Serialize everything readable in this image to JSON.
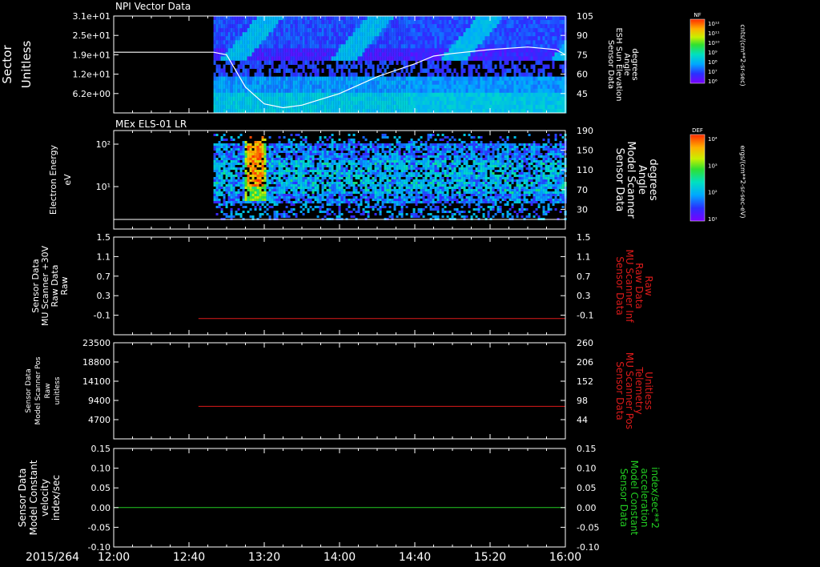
{
  "date_label": "2015/264",
  "time_ticks": [
    "12:00",
    "12:40",
    "13:20",
    "14:00",
    "14:40",
    "15:20",
    "16:00"
  ],
  "colors": {
    "white": "#ffffff",
    "red": "#dd1a1a",
    "green": "#22cc22",
    "background": "#000000"
  },
  "chart_data": [
    {
      "type": "heatmap",
      "title": "NPI Vector Data",
      "ylabel": [
        "Sector",
        "Unitless"
      ],
      "y_ticks": [
        "3.1e+01",
        "2.5e+01",
        "1.9e+01",
        "1.2e+01",
        "6.2e+00"
      ],
      "y2label": [
        "Sensor Data",
        "ESH Sun Elevation",
        "Angle",
        "degrees"
      ],
      "y2_ticks": [
        "105",
        "90",
        "75",
        "60",
        "45"
      ],
      "y2lim": [
        30,
        105
      ],
      "data_start": "12:53",
      "overlay_series": {
        "name": "ESH Sun Elevation Angle",
        "x": [
          "12:00",
          "12:53",
          "13:00",
          "13:10",
          "13:20",
          "13:30",
          "13:40",
          "14:00",
          "14:20",
          "14:40",
          "14:50",
          "15:00",
          "15:20",
          "15:40",
          "15:55",
          "16:00"
        ],
        "values": [
          77,
          77,
          75,
          50,
          37,
          34,
          36,
          45,
          58,
          68,
          74,
          76,
          79,
          81,
          79,
          75
        ]
      },
      "colorbar": {
        "label": "NF",
        "unit": "cnts/(cm**2-sr-sec)",
        "ticks": [
          "10¹²",
          "10¹¹",
          "10¹⁰",
          "10⁹",
          "10⁸",
          "10⁷",
          "10⁶"
        ]
      }
    },
    {
      "type": "heatmap",
      "title": "MEx ELS-01 LR",
      "ylabel": [
        "Electron Energy",
        "eV"
      ],
      "y_ticks": [
        "10²",
        "10¹"
      ],
      "y2label": [
        "Sensor Data",
        "Model Scanner",
        "Angle",
        "degrees"
      ],
      "y2_ticks": [
        "190",
        "150",
        "110",
        "70",
        "30"
      ],
      "data_start": "12:53",
      "burst_time": "13:15",
      "colorbar": {
        "label": "DEF",
        "unit": "ergs/(cm**2-sr-sec-eV)",
        "ticks": [
          "10⁴",
          "10³",
          "10²",
          "10¹"
        ]
      }
    },
    {
      "type": "line",
      "ylabel": [
        "Sensor Data",
        "MU Scanner +30V",
        "Raw Data",
        "Raw"
      ],
      "ylim": [
        -0.3,
        1.5
      ],
      "y_ticks": [
        "1.5",
        "1.1",
        "0.7",
        "0.3",
        "-0.1"
      ],
      "y2label": [
        "Sensor Data",
        "MU Scanner Inf",
        "Raw Data",
        "Raw"
      ],
      "y2_ticks": [
        "1.5",
        "1.1",
        "0.7",
        "0.3",
        "-0.1"
      ],
      "series": [
        {
          "name": "Sensor Data MU Scanner Inf Raw Data",
          "color": "#dd1a1a",
          "x": [
            "12:45",
            "16:00"
          ],
          "values": [
            0,
            0
          ]
        }
      ]
    },
    {
      "type": "line",
      "ylabel": [
        "Sensor Data",
        "Model Scanner Pos",
        "Raw",
        "unitless"
      ],
      "ylim": [
        0,
        23500
      ],
      "y_ticks": [
        "23500",
        "18800",
        "14100",
        "9400",
        "4700"
      ],
      "y2label": [
        "Sensor Data",
        "MU Scanner Pos",
        "Telemetry",
        "Unitless"
      ],
      "y2_ticks": [
        "260",
        "206",
        "152",
        "98",
        "44"
      ],
      "y2lim": [
        0,
        260
      ],
      "series": [
        {
          "name": "Sensor Data MU Scanner Pos Telemetry",
          "color": "#dd1a1a",
          "x": [
            "12:45",
            "16:00"
          ],
          "values": [
            88,
            88
          ]
        }
      ]
    },
    {
      "type": "line",
      "ylabel": [
        "Sensor Data",
        "Model Constant",
        "velocity",
        "index/sec"
      ],
      "ylim": [
        -0.1,
        0.15
      ],
      "y_ticks": [
        "0.15",
        "0.10",
        "0.05",
        "0.00",
        "-0.05",
        "-0.10"
      ],
      "y2label": [
        "Sensor Data",
        "Model Constant",
        "acceleration",
        "index/sec**2"
      ],
      "y2_ticks": [
        "0.15",
        "0.10",
        "0.05",
        "0.00",
        "-0.05",
        "-0.10"
      ],
      "series": [
        {
          "name": "Sensor Data Model Constant acceleration",
          "color": "#22cc22",
          "x": [
            "12:00",
            "16:00"
          ],
          "values": [
            0,
            0
          ]
        }
      ]
    }
  ]
}
